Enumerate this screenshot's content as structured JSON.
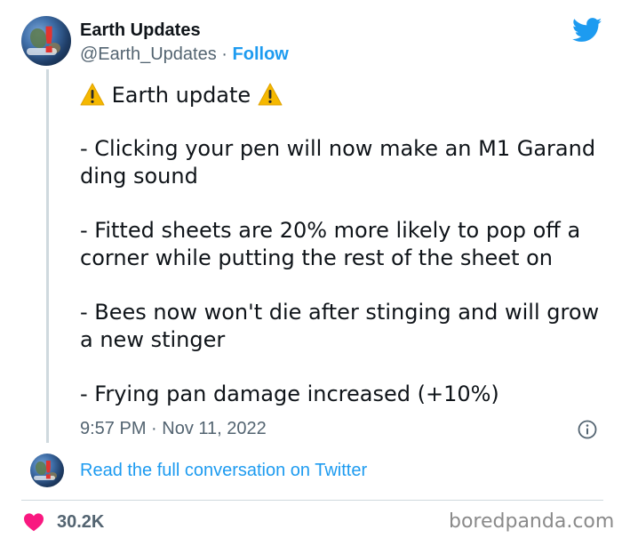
{
  "author": {
    "name": "Earth Updates",
    "handle": "@Earth_Updates",
    "separator": " · ",
    "follow_label": "Follow",
    "avatar_icon": "earth-warning-avatar"
  },
  "tweet": {
    "heading": "Earth update",
    "heading_icon": "warning-icon",
    "items": [
      "- Clicking your pen will now make an M1 Garand ding sound",
      "- Fitted sheets are 20% more likely to pop off a corner while putting the rest of the sheet on",
      "- Bees now won't die after stinging and will grow a new stinger",
      "- Frying pan damage increased (+10%)"
    ],
    "timestamp": "9:57 PM · Nov 11, 2022"
  },
  "conversation": {
    "link_label": "Read the full conversation on Twitter"
  },
  "footer": {
    "likes": "30.2K",
    "watermark": "boredpanda.com"
  },
  "colors": {
    "accent": "#1d9bf0",
    "text": "#0f1419",
    "secondary": "#536471",
    "heart": "#f91880",
    "warning": "#f5b800"
  }
}
